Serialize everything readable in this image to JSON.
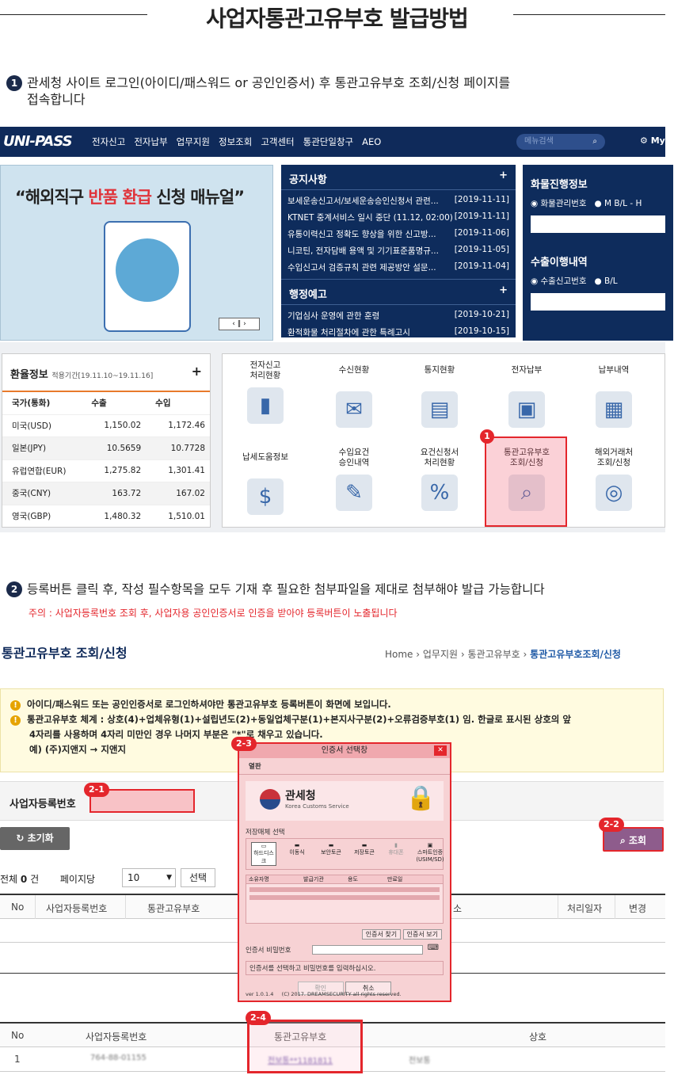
{
  "page": {
    "title": "사업자통관고유부호 발급방법"
  },
  "step1": {
    "num": "1",
    "text_line1": "관세청 사이트 로그인(아이디/패스워드 or 공인인증서) 후 통관고유부호 조회/신청 페이지를",
    "text_line2": "접속합니다"
  },
  "unipass": {
    "logo": "UNI-PASS",
    "menu": [
      "전자신고",
      "전자납부",
      "업무지원",
      "정보조회",
      "고객센터",
      "통관단일창구",
      "AEO"
    ],
    "search_placeholder": "메뉴검색",
    "my_label": "My",
    "banner_quote_pre": "“해외직구 ",
    "banner_quote_red": "반품 환급",
    "banner_quote_post": " 신청 매뉴얼”",
    "notice_title": "공지사항",
    "notices": [
      {
        "title": "보세운송신고서/보세운송승인신청서 관련...",
        "date": "[2019-11-11]"
      },
      {
        "title": "KTNET 중계서비스 일시 중단 (11.12, 02:00)",
        "date": "[2019-11-11]"
      },
      {
        "title": "유통이력신고 정확도 향상을 위한 신고방...",
        "date": "[2019-11-06]"
      },
      {
        "title": "니코틴, 전자담배 용액 및 기기표준품명규...",
        "date": "[2019-11-05]"
      },
      {
        "title": "수입신고서 검증규칙 관련 제공방안 설문...",
        "date": "[2019-11-04]"
      }
    ],
    "admin_title": "행정예고",
    "admin_notices": [
      {
        "title": "기업심사 운영에 관한 훈령",
        "date": "[2019-10-21]"
      },
      {
        "title": "환적화물 처리절차에 관한 특례고시",
        "date": "[2019-10-15]"
      }
    ],
    "cargo_title": "화물진행정보",
    "cargo_opt1": "화물관리번호",
    "cargo_opt2": "M B/L - H",
    "export_title": "수출이행내역",
    "export_opt1": "수출신고번호",
    "export_opt2": "B/L",
    "rate_title": "환율정보",
    "rate_period": "적용기간[19.11.10~19.11.16]",
    "rate_headers": [
      "국가(통화)",
      "수출",
      "수입"
    ],
    "rates": [
      {
        "c": "미국(USD)",
        "e": "1,150.02",
        "i": "1,172.46"
      },
      {
        "c": "일본(JPY)",
        "e": "10.5659",
        "i": "10.7728"
      },
      {
        "c": "유럽연합(EUR)",
        "e": "1,275.82",
        "i": "1,301.41"
      },
      {
        "c": "중국(CNY)",
        "e": "163.72",
        "i": "167.02"
      },
      {
        "c": "영국(GBP)",
        "e": "1,480.32",
        "i": "1,510.01"
      }
    ],
    "icons": [
      {
        "l1": "전자신고",
        "l2": "처리현황"
      },
      {
        "l1": "수신현황",
        "l2": ""
      },
      {
        "l1": "통지현황",
        "l2": ""
      },
      {
        "l1": "전자납부",
        "l2": ""
      },
      {
        "l1": "납부내역",
        "l2": ""
      },
      {
        "l1": "납세도움정보",
        "l2": ""
      },
      {
        "l1": "수입요건",
        "l2": "승인내역"
      },
      {
        "l1": "요건신청서",
        "l2": "처리현황"
      },
      {
        "l1": "통관고유부호",
        "l2": "조회/신청"
      },
      {
        "l1": "해외거래처",
        "l2": "조회/신청"
      }
    ],
    "badge1": "1"
  },
  "step2": {
    "num": "2",
    "text": "등록버튼 클릭 후, 작성 필수항목을 모두 기재 후 필요한 첨부파일을 제대로 첨부해야 발급 가능합니다",
    "warning": "주의 : 사업자등록번호 조회 후, 사업자용 공인인증서로 인증을 받아야 등록버튼이 노출됩니다"
  },
  "form": {
    "page_title": "통관고유부호 조회/신청",
    "crumb_home": "Home",
    "crumb_1": "업무지원",
    "crumb_2": "통관고유부호",
    "crumb_current": "통관고유부호조회/신청",
    "alert1": "아이디/패스워드 또는 공인인증서로 로그인하셔야만 통관고유부호 등록버튼이 화면에 보입니다.",
    "alert2a": "통관고유부호 체계 : 상호(4)+업체유형(1)+설립년도(2)+동일업체구분(1)+본지사구분(2)+오류검증부호(1) 임. 한글로 표시된 상호의 앞",
    "alert2b": "4자리를 사용하며 4자리 미만인 경우 나머지 부분은 \"*\"로 채우고 있습니다.",
    "alert3": "예) (주)지앤지 → 지앤지",
    "biz_label": "사업자등록번호",
    "reset_label": "초기화",
    "query_label": "조회",
    "total_pre": "전체",
    "total_count": "0",
    "total_suf": "건",
    "per_page_label": "페이지당",
    "per_page_value": "10",
    "select_label": "선택",
    "grid1_headers": [
      "No",
      "사업자등록번호",
      "통관고유부호",
      "소",
      "처리일자",
      "변경"
    ],
    "grid2_headers": [
      "No",
      "사업자등록번호",
      "통관고유부호",
      "상호"
    ],
    "grid2_row": {
      "no": "1",
      "biz": "764-88-01155",
      "code": "전보통**1181811",
      "name": "전보통"
    },
    "badges": {
      "b21": "2-1",
      "b22": "2-2",
      "b23": "2-3",
      "b24": "2-4"
    }
  },
  "dialog": {
    "title": "인증서 선택창",
    "tab": "열판",
    "brand": "관세청",
    "brand_sub": "Korea Customs Service",
    "storage_label": "저장매체 선택",
    "media": [
      "하드디스크",
      "이동식",
      "보안토큰",
      "저장토큰",
      "휴대폰",
      "스마트인증(USIM/SD)"
    ],
    "cols": [
      "소유자명",
      "발급기관",
      "용도",
      "만료일"
    ],
    "find_btn": "인증서 찾기",
    "view_btn": "인증서 보기",
    "pw_label": "인증서 비밀번호",
    "hint": "인증서를 선택하고 비밀번호를 입력하십시오.",
    "ok": "확인",
    "cancel": "취소",
    "version": "ver 1.0.1.4",
    "copyright": "(C) 2017. DREAMSECURITY all rights reserved."
  }
}
